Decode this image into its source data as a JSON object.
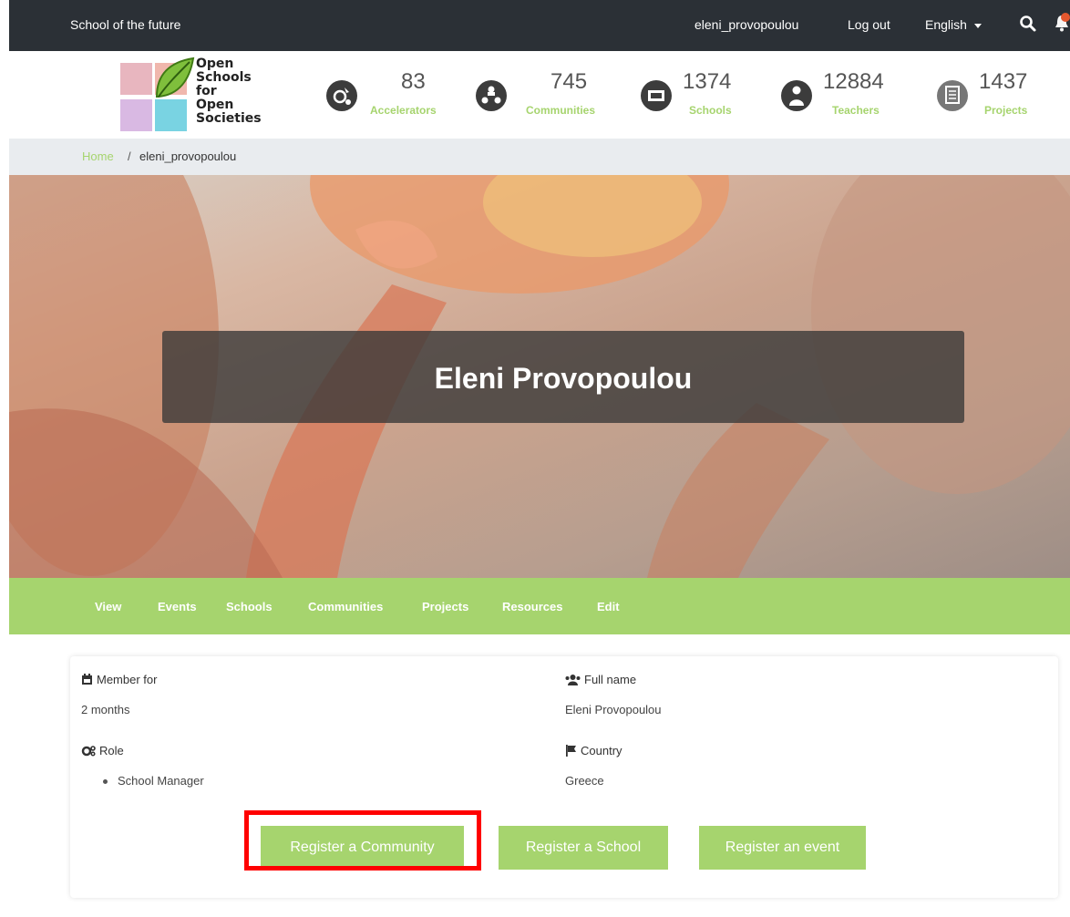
{
  "topbar": {
    "brand": "School of the future",
    "username": "eleni_provopoulou",
    "logout": "Log out",
    "language": "English",
    "search_icon": "search-icon",
    "bell_icon": "bell-icon"
  },
  "logo": {
    "line1": "Open",
    "line2": "Schools for",
    "line3": "Open",
    "line4": "Societies",
    "colors": [
      "#e8b6bf",
      "#f0b7ad",
      "#d9b9e3",
      "#79d3e2"
    ],
    "leaf_color": "#7fbf3c"
  },
  "stats": [
    {
      "value": "83",
      "label": "Accelerators",
      "icon": "accelerator-icon"
    },
    {
      "value": "745",
      "label": "Communities",
      "icon": "communities-icon"
    },
    {
      "value": "1374",
      "label": "Schools",
      "icon": "schools-icon"
    },
    {
      "value": "12884",
      "label": "Teachers",
      "icon": "teachers-icon"
    },
    {
      "value": "1437",
      "label": "Projects",
      "icon": "projects-icon"
    }
  ],
  "breadcrumb": {
    "home": "Home",
    "separator": "/",
    "current": "eleni_provopoulou"
  },
  "profile": {
    "name": "Eleni Provopoulou"
  },
  "tabs": [
    "View",
    "Events",
    "Schools",
    "Communities",
    "Projects",
    "Resources",
    "Edit"
  ],
  "details": {
    "member_for_label": "Member for",
    "member_for_value": "2 months",
    "role_label": "Role",
    "role_value": "School Manager",
    "full_name_label": "Full name",
    "full_name_value": "Eleni Provopoulou",
    "country_label": "Country",
    "country_value": "Greece"
  },
  "buttons": {
    "register_community": "Register a Community",
    "register_school": "Register a School",
    "register_event": "Register an event"
  },
  "colors": {
    "accent": "#a6d46e",
    "topbar": "#2b3036",
    "highlight": "#ff0000"
  }
}
